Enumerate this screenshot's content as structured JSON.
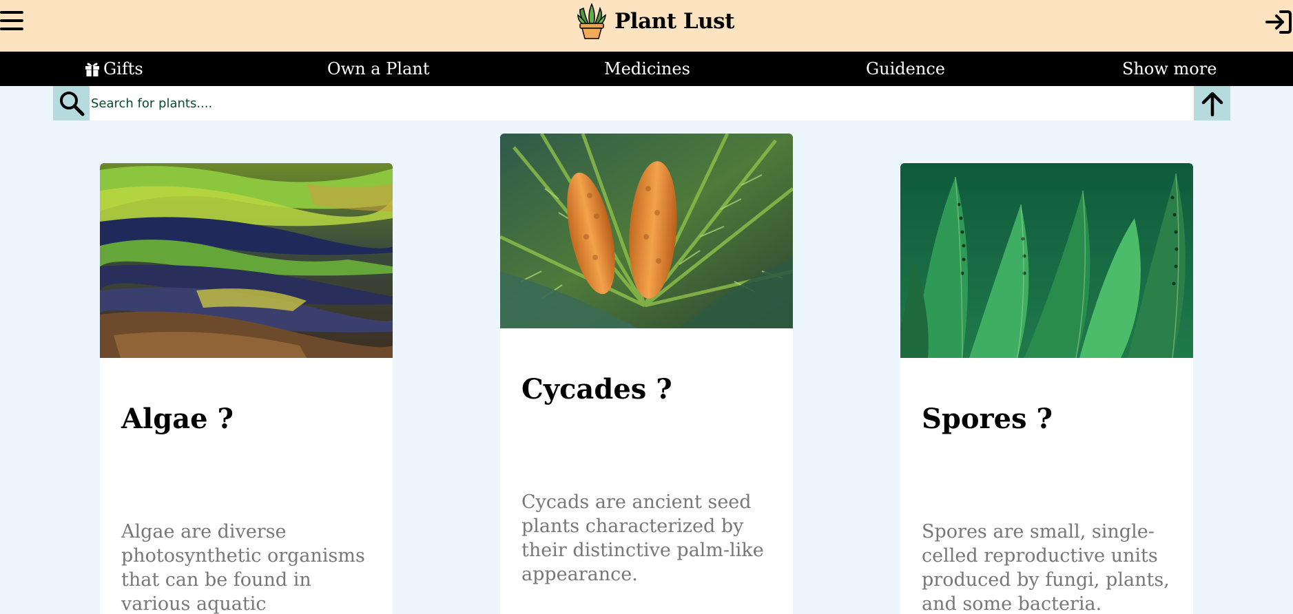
{
  "header": {
    "site_title": "Plant Lust",
    "icons": {
      "menu": "hamburger-menu-icon",
      "logo": "potted-plant-logo",
      "login": "login-arrow-icon"
    },
    "colors": {
      "header_bg": "#fde3c0",
      "nav_bg": "#000000",
      "page_bg": "#eef6fd",
      "accent": "#b6dbdf"
    }
  },
  "nav": {
    "items": [
      {
        "label": "Gifts",
        "icon": "gift-icon"
      },
      {
        "label": "Own a Plant"
      },
      {
        "label": "Medicines"
      },
      {
        "label": "Guidence"
      },
      {
        "label": "Show more"
      }
    ]
  },
  "search": {
    "placeholder": "Search for plants....",
    "value": "",
    "icons": {
      "search": "search-icon",
      "scroll_top": "arrow-up-icon"
    }
  },
  "cards": [
    {
      "title": "Algae ?",
      "text": "Algae are diverse photosynthetic organisms that can be found in various aquatic",
      "image": "algae-seaweed-photo"
    },
    {
      "title": "Cycades ?",
      "text": "Cycads are ancient seed plants characterized by their distinctive palm-like appearance.",
      "image": "cycad-cones-photo"
    },
    {
      "title": "Spores ?",
      "text": "Spores are small, single-celled reproductive units produced by fungi, plants, and some bacteria.",
      "image": "fern-spores-photo"
    }
  ]
}
